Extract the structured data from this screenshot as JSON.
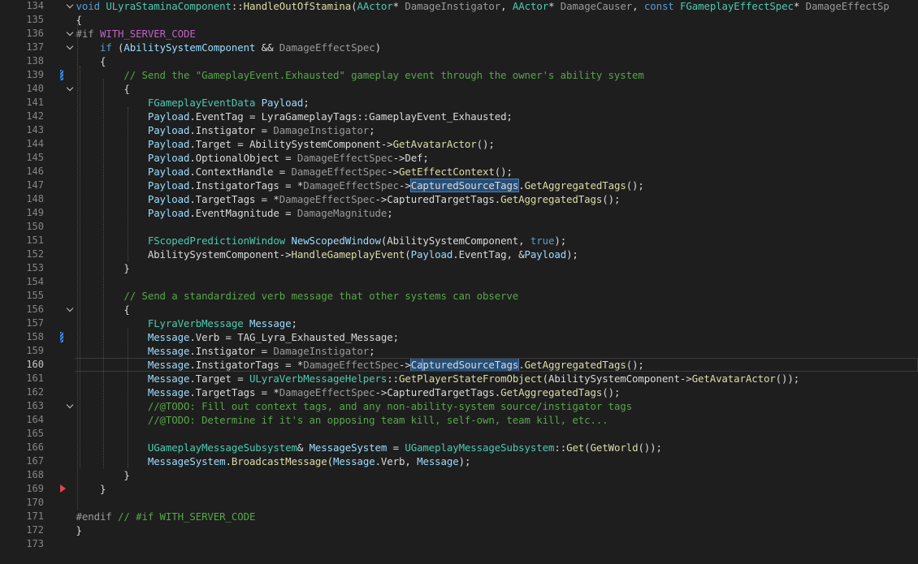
{
  "editor": {
    "current_line": 160,
    "lines": [
      {
        "n": 134,
        "fold": true,
        "mark": "",
        "tokens": [
          [
            "v",
            "k"
          ],
          [
            "oid ",
            "k"
          ],
          [
            "ULyraStaminaComponent",
            "t"
          ],
          [
            "::",
            ""
          ],
          [
            "HandleOutOfStamina",
            "f"
          ],
          [
            "(",
            ""
          ],
          [
            "AActor",
            "t"
          ],
          [
            "* ",
            ""
          ],
          [
            "DamageInstigator",
            "v"
          ],
          [
            ", ",
            ""
          ],
          [
            "AActor",
            "t"
          ],
          [
            "* ",
            ""
          ],
          [
            "DamageCauser",
            "v"
          ],
          [
            ", ",
            ""
          ],
          [
            "const ",
            "k"
          ],
          [
            "FGameplayEffectSpec",
            "t"
          ],
          [
            "* ",
            ""
          ],
          [
            "DamageEffectSp",
            "v"
          ]
        ]
      },
      {
        "n": 135,
        "fold": false,
        "mark": "",
        "tokens": [
          [
            "{",
            ""
          ]
        ]
      },
      {
        "n": 136,
        "fold": true,
        "mark": "",
        "tokens": [
          [
            "#",
            "pp"
          ],
          [
            "if ",
            "pp"
          ],
          [
            "WITH_SERVER_CODE",
            "m"
          ]
        ]
      },
      {
        "n": 137,
        "fold": true,
        "mark": "",
        "tokens": [
          [
            "    ",
            ""
          ],
          [
            "if ",
            "k"
          ],
          [
            "(",
            ""
          ],
          [
            "AbilitySystemComponent",
            "p"
          ],
          [
            " && ",
            ""
          ],
          [
            "DamageEffectSpec",
            "v"
          ],
          [
            ")",
            ""
          ]
        ]
      },
      {
        "n": 138,
        "fold": false,
        "mark": "",
        "tokens": [
          [
            "    {",
            ""
          ]
        ]
      },
      {
        "n": 139,
        "fold": false,
        "mark": "change",
        "tokens": [
          [
            "        ",
            ""
          ],
          [
            "// Send the \"GameplayEvent.Exhausted\" gameplay event through the owner's ability system",
            "c"
          ]
        ]
      },
      {
        "n": 140,
        "fold": true,
        "mark": "",
        "tokens": [
          [
            "        {",
            ""
          ]
        ]
      },
      {
        "n": 141,
        "fold": false,
        "mark": "",
        "tokens": [
          [
            "            ",
            ""
          ],
          [
            "FGameplayEventData ",
            "t"
          ],
          [
            "Payload",
            "p"
          ],
          [
            ";",
            ""
          ]
        ]
      },
      {
        "n": 142,
        "fold": false,
        "mark": "",
        "tokens": [
          [
            "            ",
            ""
          ],
          [
            "Payload",
            "p"
          ],
          [
            ".EventTag = LyraGameplayTags::GameplayEvent_Exhausted;",
            ""
          ]
        ]
      },
      {
        "n": 143,
        "fold": false,
        "mark": "",
        "tokens": [
          [
            "            ",
            ""
          ],
          [
            "Payload",
            "p"
          ],
          [
            ".Instigator = ",
            ""
          ],
          [
            "DamageInstigator",
            "v"
          ],
          [
            ";",
            ""
          ]
        ]
      },
      {
        "n": 144,
        "fold": false,
        "mark": "",
        "tokens": [
          [
            "            ",
            ""
          ],
          [
            "Payload",
            "p"
          ],
          [
            ".Target = AbilitySystemComponent->",
            ""
          ],
          [
            "GetAvatarActor",
            "f"
          ],
          [
            "();",
            ""
          ]
        ]
      },
      {
        "n": 145,
        "fold": false,
        "mark": "",
        "tokens": [
          [
            "            ",
            ""
          ],
          [
            "Payload",
            "p"
          ],
          [
            ".OptionalObject = ",
            ""
          ],
          [
            "DamageEffectSpec",
            "v"
          ],
          [
            "->Def;",
            ""
          ]
        ]
      },
      {
        "n": 146,
        "fold": false,
        "mark": "",
        "tokens": [
          [
            "            ",
            ""
          ],
          [
            "Payload",
            "p"
          ],
          [
            ".ContextHandle = ",
            ""
          ],
          [
            "DamageEffectSpec",
            "v"
          ],
          [
            "->",
            ""
          ],
          [
            "GetEffectContext",
            "f"
          ],
          [
            "();",
            ""
          ]
        ]
      },
      {
        "n": 147,
        "fold": false,
        "mark": "",
        "tokens": [
          [
            "            ",
            ""
          ],
          [
            "Payload",
            "p"
          ],
          [
            ".InstigatorTags = *",
            ""
          ],
          [
            "DamageEffectSpec",
            "v"
          ],
          [
            "->",
            ""
          ],
          [
            "CapturedSourceTags",
            "sel"
          ],
          [
            ".",
            ""
          ],
          [
            "GetAggregatedTags",
            "f"
          ],
          [
            "();",
            ""
          ]
        ]
      },
      {
        "n": 148,
        "fold": false,
        "mark": "",
        "tokens": [
          [
            "            ",
            ""
          ],
          [
            "Payload",
            "p"
          ],
          [
            ".TargetTags = *",
            ""
          ],
          [
            "DamageEffectSpec",
            "v"
          ],
          [
            "->CapturedTargetTags.",
            ""
          ],
          [
            "GetAggregatedTags",
            "f"
          ],
          [
            "();",
            ""
          ]
        ]
      },
      {
        "n": 149,
        "fold": false,
        "mark": "",
        "tokens": [
          [
            "            ",
            ""
          ],
          [
            "Payload",
            "p"
          ],
          [
            ".EventMagnitude = ",
            ""
          ],
          [
            "DamageMagnitude",
            "v"
          ],
          [
            ";",
            ""
          ]
        ]
      },
      {
        "n": 150,
        "fold": false,
        "mark": "",
        "tokens": []
      },
      {
        "n": 151,
        "fold": false,
        "mark": "",
        "tokens": [
          [
            "            ",
            ""
          ],
          [
            "FScopedPredictionWindow ",
            "t"
          ],
          [
            "NewScopedWindow",
            "p"
          ],
          [
            "(AbilitySystemComponent, ",
            ""
          ],
          [
            "true",
            "k"
          ],
          [
            ");",
            ""
          ]
        ]
      },
      {
        "n": 152,
        "fold": false,
        "mark": "",
        "tokens": [
          [
            "            AbilitySystemComponent->",
            ""
          ],
          [
            "HandleGameplayEvent",
            "f"
          ],
          [
            "(",
            ""
          ],
          [
            "Payload",
            "p"
          ],
          [
            ".EventTag, &",
            ""
          ],
          [
            "Payload",
            "p"
          ],
          [
            ");",
            ""
          ]
        ]
      },
      {
        "n": 153,
        "fold": false,
        "mark": "",
        "tokens": [
          [
            "        }",
            ""
          ]
        ]
      },
      {
        "n": 154,
        "fold": false,
        "mark": "",
        "tokens": []
      },
      {
        "n": 155,
        "fold": false,
        "mark": "",
        "tokens": [
          [
            "        ",
            ""
          ],
          [
            "// Send a standardized verb message that other systems can observe",
            "c"
          ]
        ]
      },
      {
        "n": 156,
        "fold": true,
        "mark": "",
        "tokens": [
          [
            "        {",
            ""
          ]
        ]
      },
      {
        "n": 157,
        "fold": false,
        "mark": "",
        "tokens": [
          [
            "            ",
            ""
          ],
          [
            "FLyraVerbMessage ",
            "t"
          ],
          [
            "Message",
            "p"
          ],
          [
            ";",
            ""
          ]
        ]
      },
      {
        "n": 158,
        "fold": false,
        "mark": "change",
        "tokens": [
          [
            "            ",
            ""
          ],
          [
            "Message",
            "p"
          ],
          [
            ".Verb = TAG_Lyra_Exhausted_Message;",
            ""
          ]
        ]
      },
      {
        "n": 159,
        "fold": false,
        "mark": "",
        "tokens": [
          [
            "            ",
            ""
          ],
          [
            "Message",
            "p"
          ],
          [
            ".Instigator = ",
            ""
          ],
          [
            "DamageInstigator",
            "v"
          ],
          [
            ";",
            ""
          ]
        ]
      },
      {
        "n": 160,
        "fold": false,
        "mark": "",
        "tokens": [
          [
            "            ",
            ""
          ],
          [
            "Message",
            "p"
          ],
          [
            ".InstigatorTags = *",
            ""
          ],
          [
            "DamageEffectSpec",
            "v"
          ],
          [
            "->",
            ""
          ],
          [
            "Ca",
            "sel"
          ],
          [
            "|",
            "caret"
          ],
          [
            "pturedSourceTags",
            "sel"
          ],
          [
            ".",
            ""
          ],
          [
            "GetAggregatedTags",
            "f"
          ],
          [
            "();",
            ""
          ]
        ]
      },
      {
        "n": 161,
        "fold": false,
        "mark": "",
        "tokens": [
          [
            "            ",
            ""
          ],
          [
            "Message",
            "p"
          ],
          [
            ".Target = ",
            ""
          ],
          [
            "ULyraVerbMessageHelpers",
            "t"
          ],
          [
            "::",
            ""
          ],
          [
            "GetPlayerStateFromObject",
            "f"
          ],
          [
            "(AbilitySystemComponent->",
            ""
          ],
          [
            "GetAvatarActor",
            "f"
          ],
          [
            "());",
            ""
          ]
        ]
      },
      {
        "n": 162,
        "fold": false,
        "mark": "",
        "tokens": [
          [
            "            ",
            ""
          ],
          [
            "Message",
            "p"
          ],
          [
            ".TargetTags = *",
            ""
          ],
          [
            "DamageEffectSpec",
            "v"
          ],
          [
            "->CapturedTargetTags.",
            ""
          ],
          [
            "GetAggregatedTags",
            "f"
          ],
          [
            "();",
            ""
          ]
        ]
      },
      {
        "n": 163,
        "fold": true,
        "mark": "",
        "tokens": [
          [
            "            ",
            ""
          ],
          [
            "//@TODO: Fill out context tags, and any non-ability-system source/instigator tags",
            "c"
          ]
        ]
      },
      {
        "n": 164,
        "fold": false,
        "mark": "",
        "tokens": [
          [
            "            ",
            ""
          ],
          [
            "//@TODO: Determine if it's an opposing team kill, self-own, team kill, etc...",
            "c"
          ]
        ]
      },
      {
        "n": 165,
        "fold": false,
        "mark": "",
        "tokens": []
      },
      {
        "n": 166,
        "fold": false,
        "mark": "",
        "tokens": [
          [
            "            ",
            ""
          ],
          [
            "UGameplayMessageSubsystem",
            "t"
          ],
          [
            "& ",
            ""
          ],
          [
            "MessageSystem",
            "p"
          ],
          [
            " = ",
            ""
          ],
          [
            "UGameplayMessageSubsystem",
            "t"
          ],
          [
            "::",
            ""
          ],
          [
            "Get",
            "f"
          ],
          [
            "(",
            ""
          ],
          [
            "GetWorld",
            "f"
          ],
          [
            "());",
            ""
          ]
        ]
      },
      {
        "n": 167,
        "fold": false,
        "mark": "",
        "tokens": [
          [
            "            ",
            ""
          ],
          [
            "MessageSystem",
            "p"
          ],
          [
            ".",
            ""
          ],
          [
            "BroadcastMessage",
            "f"
          ],
          [
            "(",
            ""
          ],
          [
            "Message",
            "p"
          ],
          [
            ".Verb, ",
            ""
          ],
          [
            "Message",
            "p"
          ],
          [
            ");",
            ""
          ]
        ]
      },
      {
        "n": 168,
        "fold": false,
        "mark": "",
        "tokens": [
          [
            "        }",
            ""
          ]
        ]
      },
      {
        "n": 169,
        "fold": false,
        "mark": "breakpoint",
        "tokens": [
          [
            "    }",
            ""
          ]
        ]
      },
      {
        "n": 170,
        "fold": false,
        "mark": "",
        "tokens": []
      },
      {
        "n": 171,
        "fold": false,
        "mark": "",
        "tokens": [
          [
            "#endif ",
            "pp"
          ],
          [
            "// #if WITH_SERVER_CODE",
            "c"
          ]
        ]
      },
      {
        "n": 172,
        "fold": false,
        "mark": "",
        "tokens": [
          [
            "}",
            ""
          ]
        ]
      },
      {
        "n": 173,
        "fold": false,
        "mark": "",
        "tokens": []
      }
    ]
  }
}
